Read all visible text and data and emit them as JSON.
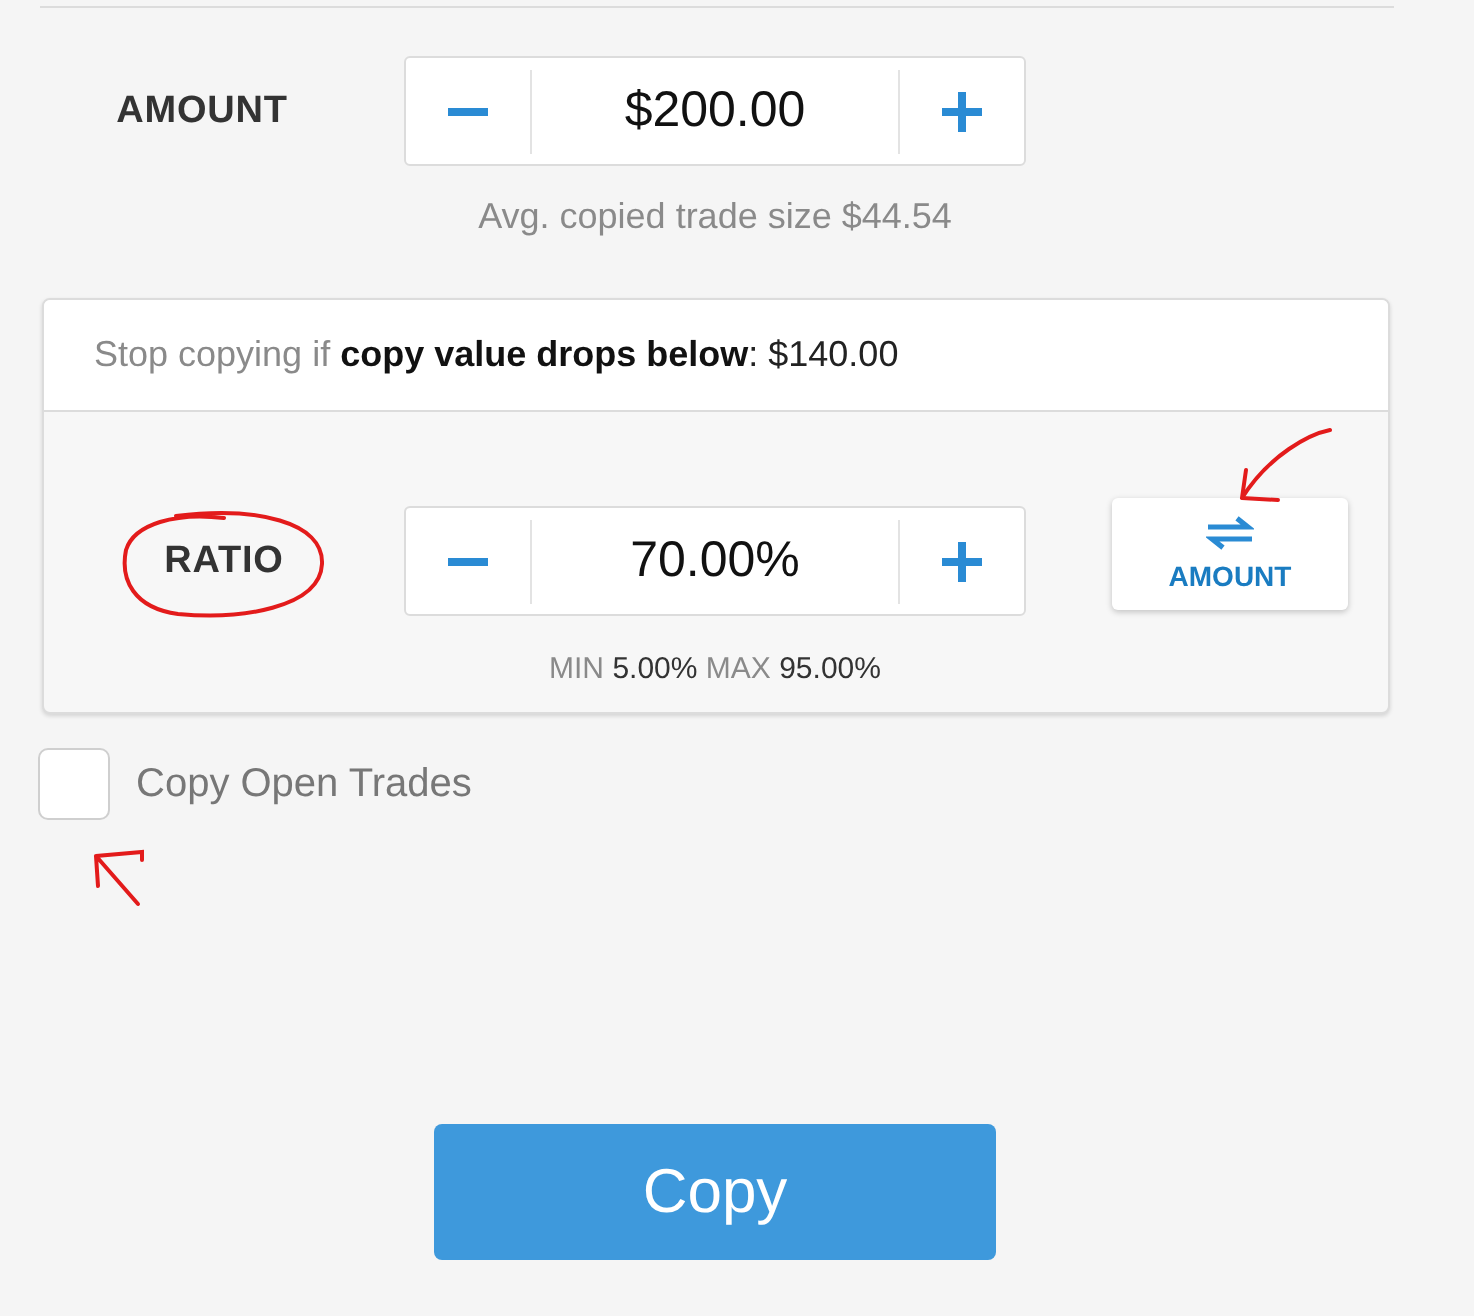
{
  "amount": {
    "label": "AMOUNT",
    "value": "$200.00",
    "hint": "Avg. copied trade size $44.54"
  },
  "stop_copying": {
    "prefix": "Stop copying if",
    "text": "**copy value drops below**: $140.00"
  },
  "ratio": {
    "label": "RATIO",
    "value": "70.00%",
    "limits": [
      {
        "label": "MIN",
        "value": "5.00%"
      },
      {
        "label": "MAX",
        "value": "95.00%"
      }
    ]
  },
  "mode_button": {
    "label": "AMOUNT"
  },
  "copy_open_trades": {
    "label": "Copy Open Trades",
    "checked": false
  },
  "copy_button": {
    "label": "Copy"
  }
}
